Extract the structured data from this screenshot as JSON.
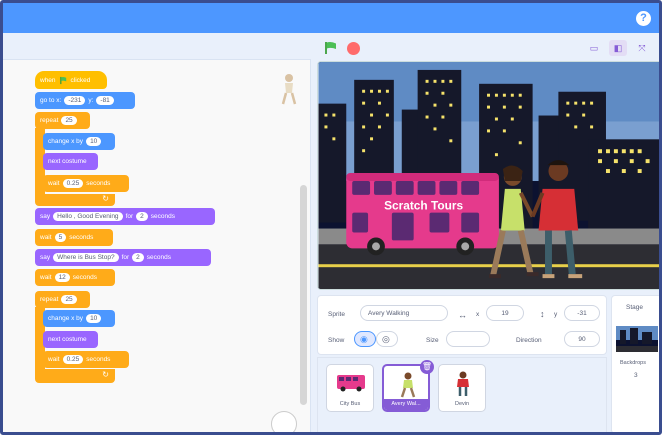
{
  "header": {
    "help_icon": "?"
  },
  "blocks": {
    "when_flag": "when",
    "when_flag_tail": "clicked",
    "goto_label": "go to x:",
    "goto_x": "-231",
    "goto_y_label": "y:",
    "goto_y": "-81",
    "repeat1_label": "repeat",
    "repeat1_count": "25",
    "change_x1_label": "change x by",
    "change_x1_value": "10",
    "next_costume1": "next costume",
    "wait1_label": "wait",
    "wait1_value": "0.25",
    "wait1_unit": "seconds",
    "say1_label": "say",
    "say1_text": "Hello , Good Evening",
    "say1_for": "for",
    "say1_secs": "2",
    "say1_unit": "seconds",
    "wait2_label": "wait",
    "wait2_value": "5",
    "wait2_unit": "seconds",
    "say2_label": "say",
    "say2_text": "Where is Bus Stop?",
    "say2_for": "for",
    "say2_secs": "2",
    "say2_unit": "seconds",
    "wait3_label": "wait",
    "wait3_value": "12",
    "wait3_unit": "seconds",
    "repeat2_label": "repeat",
    "repeat2_count": "25",
    "change_x2_label": "change x by",
    "change_x2_value": "10",
    "next_costume2": "next costume",
    "wait4_label": "wait",
    "wait4_value": "0.25",
    "wait4_unit": "seconds"
  },
  "stage": {
    "bus_text": "Scratch Tours"
  },
  "info": {
    "sprite_label": "Sprite",
    "sprite_name": "Avery Walking",
    "x_label": "x",
    "x_value": "19",
    "y_label": "y",
    "y_value": "-31",
    "show_label": "Show",
    "size_label": "Size",
    "size_value": "",
    "direction_label": "Direction",
    "direction_value": "90"
  },
  "sprites": [
    {
      "name": "City Bus"
    },
    {
      "name": "Avery Wal..."
    },
    {
      "name": "Devin"
    }
  ],
  "stage_pane": {
    "title": "Stage",
    "backdrops_label": "Backdrops",
    "backdrops_count": "3"
  },
  "colors": {
    "menubar": "#4d97ff",
    "events": "#ffbf00",
    "motion": "#4c97ff",
    "looks": "#9966ff",
    "control": "#ffab19",
    "selection": "#855cd6"
  }
}
